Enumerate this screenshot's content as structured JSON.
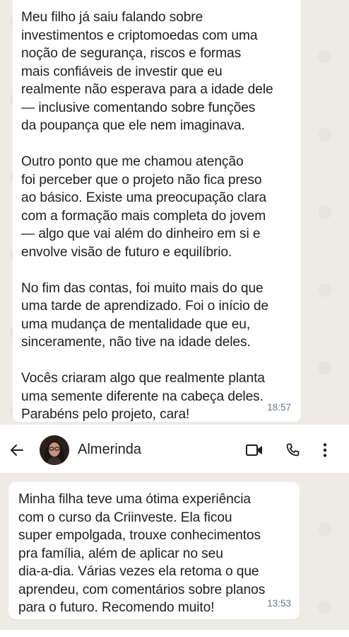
{
  "top_message": {
    "paragraphs": [
      [
        "Meu filho já saiu falando sobre",
        "investimentos e criptomoedas com uma",
        "noção de segurança, riscos e formas",
        "mais confiáveis de investir que eu",
        "realmente não esperava para a idade dele",
        "— inclusive comentando sobre funções",
        "da poupança que ele nem imaginava."
      ],
      [
        "Outro ponto que me chamou atenção",
        "foi perceber que o projeto não fica preso",
        "ao básico. Existe uma preocupação clara",
        "com a formação mais completa do jovem",
        "— algo que vai além do dinheiro em si e",
        "envolve visão de futuro e equilíbrio."
      ],
      [
        "No fim das contas, foi muito mais do que",
        "uma tarde de aprendizado. Foi o início de",
        "uma mudança de mentalidade que eu,",
        "sinceramente, não tive na idade deles."
      ],
      [
        "Vocês criaram algo que realmente planta",
        "uma semente diferente na cabeça deles.",
        "Parabéns pelo projeto, cara!"
      ]
    ],
    "time": "18:57"
  },
  "header": {
    "contact_name": "Almerinda",
    "icons": [
      "back-arrow-icon",
      "video-call-icon",
      "phone-icon",
      "more-vertical-icon"
    ]
  },
  "bottom_message": {
    "lines": [
      "Minha filha teve uma ótima experiência",
      "com o curso da Criinveste. Ela ficou",
      "super empolgada, trouxe conhecimentos",
      "pra família, além de aplicar no seu",
      "dia-a-dia. Várias vezes ela retoma o que",
      "aprendeu, com comentários sobre planos",
      "para o futuro. Recomendo muito!"
    ],
    "time": "13:53"
  },
  "colors": {
    "chat_background": "#eeebe4",
    "bubble": "#ffffff",
    "timestamp": "#667781",
    "text": "#1f1f1f"
  }
}
